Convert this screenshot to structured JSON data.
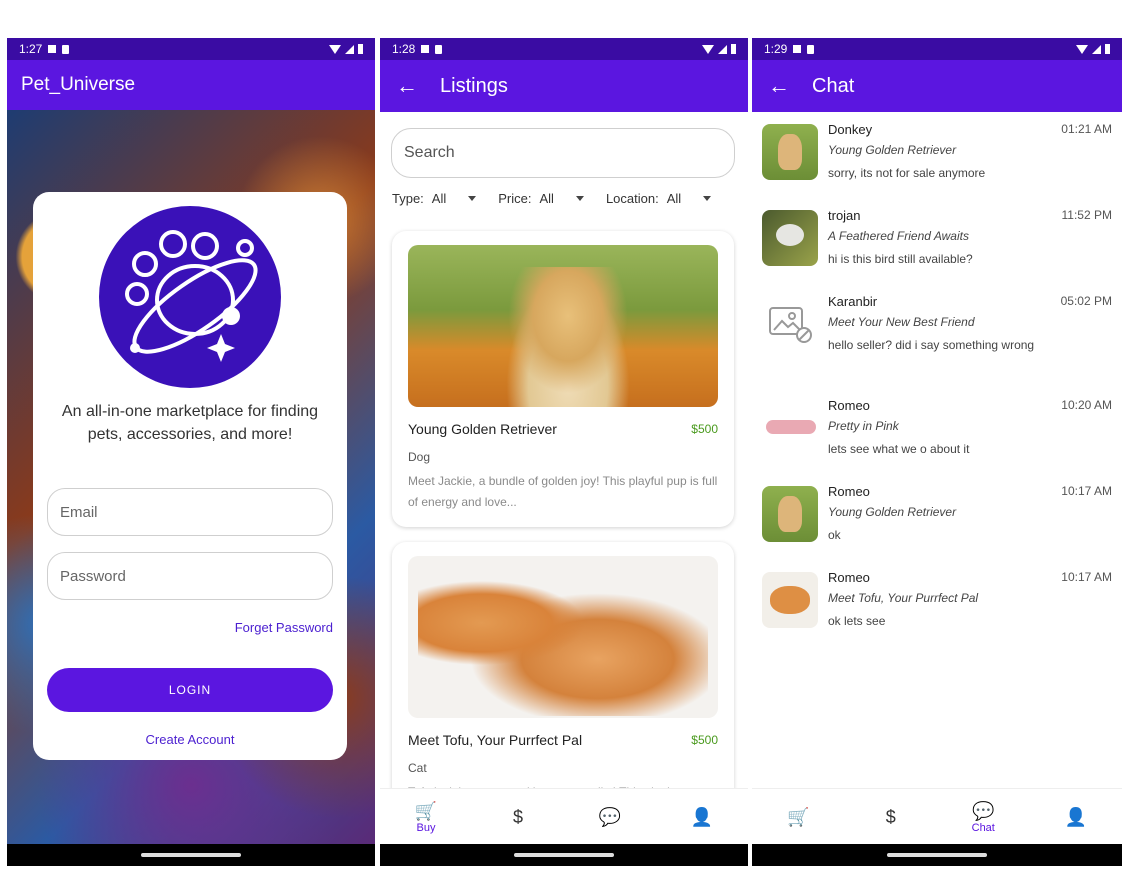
{
  "screens": {
    "login": {
      "status_time": "1:27",
      "app_title": "Pet_Universe",
      "tagline": "An all-in-one marketplace for finding pets, accessories, and more!",
      "email_placeholder": "Email",
      "password_placeholder": "Password",
      "forgot_label": "Forget Password",
      "login_label": "LOGIN",
      "create_label": "Create Account"
    },
    "listings": {
      "status_time": "1:28",
      "title": "Listings",
      "search_placeholder": "Search",
      "filters": [
        {
          "label": "Type:",
          "value": "All"
        },
        {
          "label": "Price:",
          "value": "All"
        },
        {
          "label": "Location:",
          "value": "All"
        }
      ],
      "items": [
        {
          "title": "Young Golden Retriever",
          "price": "$500",
          "category": "Dog",
          "description": "Meet Jackie, a bundle of golden joy! This playful pup is full of energy and love..."
        },
        {
          "title": "Meet Tofu, Your Purrfect Pal",
          "price": "$500",
          "category": "Cat",
          "description": "Tofu isn't just a name, it's a personality! This sleek"
        }
      ],
      "tabs": [
        {
          "icon": "cart-icon",
          "glyph": "🛒",
          "label": "Buy"
        },
        {
          "icon": "dollar-icon",
          "glyph": "$",
          "label": ""
        },
        {
          "icon": "chat-bubble-icon",
          "glyph": "💬",
          "label": ""
        },
        {
          "icon": "person-icon",
          "glyph": "👤",
          "label": ""
        }
      ]
    },
    "chat": {
      "status_time": "1:29",
      "title": "Chat",
      "conversations": [
        {
          "name": "Donkey",
          "time": "01:21 AM",
          "listing": "Young Golden Retriever",
          "message": "sorry, its not for sale anymore"
        },
        {
          "name": "trojan",
          "time": "11:52 PM",
          "listing": "A Feathered Friend Awaits",
          "message": "hi is this bird still available?"
        },
        {
          "name": "Karanbir",
          "time": "05:02 PM",
          "listing": "Meet Your New Best Friend",
          "message": "hello seller? did i say something wrong"
        },
        {
          "name": "Romeo",
          "time": "10:20 AM",
          "listing": "Pretty in Pink",
          "message": "lets see what we o about it"
        },
        {
          "name": "Romeo",
          "time": "10:17 AM",
          "listing": "Young Golden Retriever",
          "message": "ok"
        },
        {
          "name": "Romeo",
          "time": "10:17 AM",
          "listing": "Meet Tofu, Your Purrfect Pal",
          "message": "ok lets see"
        }
      ],
      "tabs": [
        {
          "icon": "cart-icon",
          "glyph": "🛒",
          "label": ""
        },
        {
          "icon": "dollar-icon",
          "glyph": "$",
          "label": ""
        },
        {
          "icon": "chat-bubble-icon",
          "glyph": "💬",
          "label": "Chat"
        },
        {
          "icon": "person-icon",
          "glyph": "👤",
          "label": ""
        }
      ]
    }
  },
  "colors": {
    "primary": "#5b16e0",
    "status_bar": "#3a0ca3",
    "price": "#4a9a1e",
    "link": "#4b1fd0"
  }
}
